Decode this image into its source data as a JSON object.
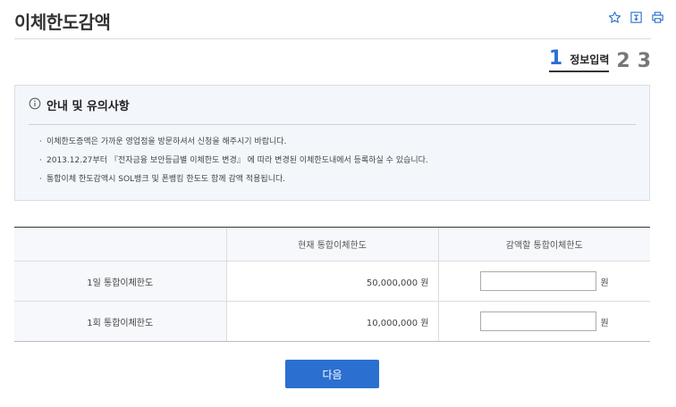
{
  "page": {
    "title": "이체한도감액"
  },
  "header_icons": [
    "star-icon",
    "download-icon",
    "print-icon"
  ],
  "steps": [
    {
      "number": "1",
      "label": "정보입력",
      "active": true
    },
    {
      "number": "2",
      "active": false
    },
    {
      "number": "3",
      "active": false
    }
  ],
  "notice": {
    "title": "안내 및 유의사항",
    "items": [
      "이체한도증액은 가까운 영업점을 방문하셔서 신청을 해주시기 바랍니다.",
      "2013.12.27부터 『전자금융 보안등급별 이체한도 변경』 에 따라 변경된 이체한도내에서 등록하실 수 있습니다.",
      "통합이체 한도감액시 SOL뱅크 및 폰뱅킹 한도도 함께 감액 적용됩니다."
    ]
  },
  "table": {
    "headers": [
      "",
      "현재 통합이체한도",
      "감액할 통합이체한도"
    ],
    "rows": [
      {
        "name": "1일 통합이체한도",
        "amount": "50,000,000 원",
        "input_value": "",
        "unit": "원"
      },
      {
        "name": "1회 통합이체한도",
        "amount": "10,000,000 원",
        "input_value": "",
        "unit": "원"
      }
    ]
  },
  "buttons": {
    "next": "다음"
  },
  "colors": {
    "accent": "#2b6fd0",
    "step_active": "#2a6fd6",
    "notice_bg": "#f3f7fc"
  }
}
